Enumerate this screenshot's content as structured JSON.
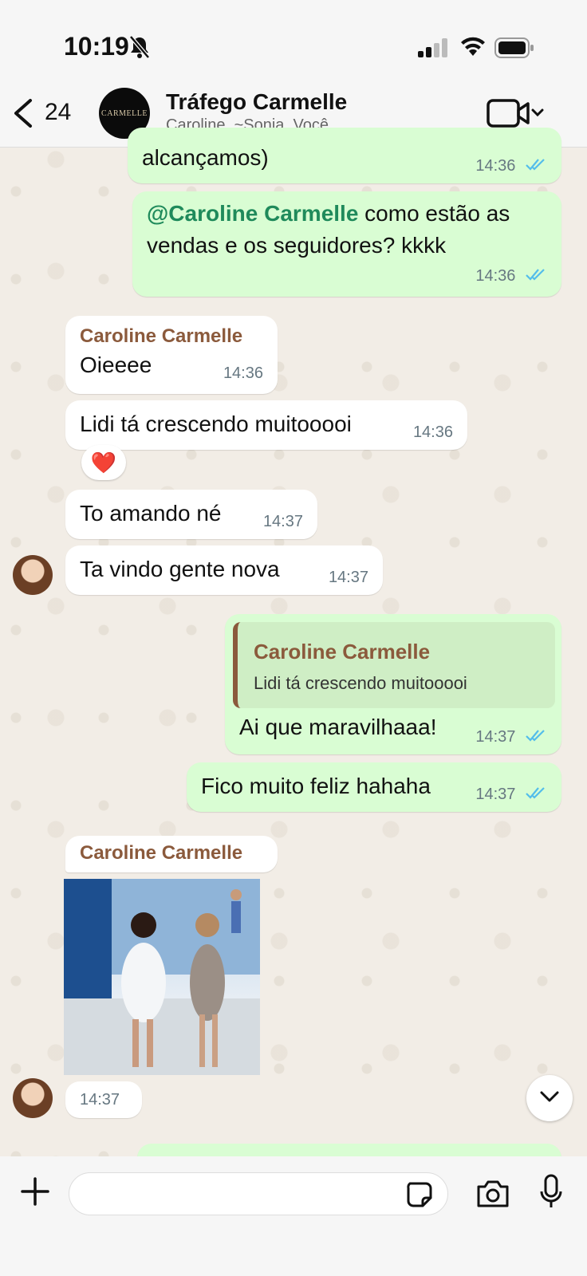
{
  "status_bar": {
    "time": "10:19"
  },
  "header": {
    "back_count": "24",
    "avatar_text": "CARMELLE",
    "title": "Tráfego Carmelle",
    "members": "Caroline, ~Sonia, Você"
  },
  "messages": [
    {
      "text": "alcançamos)",
      "time": "14:36"
    },
    {
      "mention": "@Caroline Carmelle",
      "text": " como estão as vendas e os seguidores? kkkk",
      "time": "14:36"
    },
    {
      "sender": "Caroline Carmelle",
      "text": "Oieeee",
      "time": "14:36"
    },
    {
      "text": "Lidi tá crescendo muitooooi",
      "time": "14:36",
      "reaction": "❤️"
    },
    {
      "text": "To amando né",
      "time": "14:37"
    },
    {
      "text": "Ta vindo gente nova",
      "time": "14:37"
    },
    {
      "quote_sender": "Caroline Carmelle",
      "quote_text": "Lidi tá crescendo muitooooi",
      "text": "Ai que maravilhaaa!",
      "time": "14:37"
    },
    {
      "text": "Fico muito feliz hahaha",
      "time": "14:37"
    },
    {
      "sender": "Caroline Carmelle",
      "time": "14:37"
    }
  ],
  "composer": {
    "placeholder": ""
  }
}
